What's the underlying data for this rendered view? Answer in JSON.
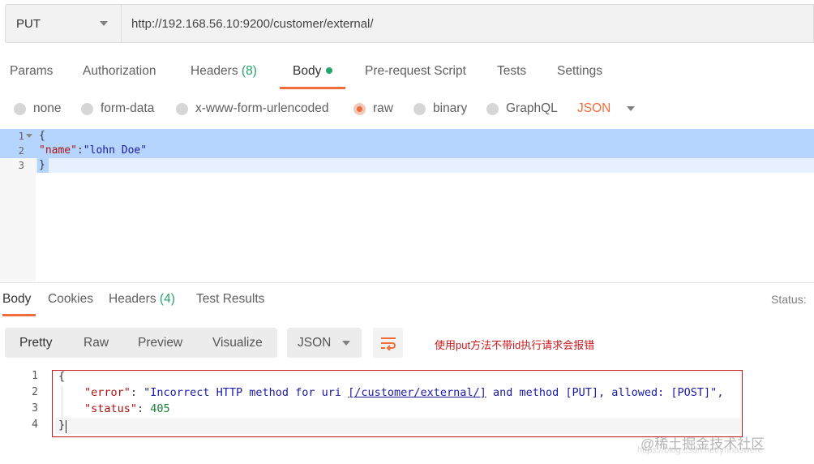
{
  "request": {
    "method": "PUT",
    "url": "http://192.168.56.10:9200/customer/external/"
  },
  "request_tabs": {
    "params": "Params",
    "authorization": "Authorization",
    "headers": "Headers",
    "headers_count": "(8)",
    "body": "Body",
    "pre_request": "Pre-request Script",
    "tests": "Tests",
    "settings": "Settings"
  },
  "body_types": {
    "none": "none",
    "form_data": "form-data",
    "urlencoded": "x-www-form-urlencoded",
    "raw": "raw",
    "binary": "binary",
    "graphql": "GraphQL",
    "selected": "raw",
    "language": "JSON"
  },
  "request_body": {
    "line_numbers": [
      "1",
      "2",
      "3"
    ],
    "line1": "{",
    "line2_key": "\"name\"",
    "line2_colon": ":",
    "line2_value": "\"lohn Doe\"",
    "line3": "}"
  },
  "response_tabs": {
    "body": "Body",
    "cookies": "Cookies",
    "headers": "Headers",
    "headers_count": "(4)",
    "test_results": "Test Results",
    "status": "Status:"
  },
  "response_toolbar": {
    "pretty": "Pretty",
    "raw": "Raw",
    "preview": "Preview",
    "visualize": "Visualize",
    "format": "JSON",
    "wrap_icon": "wrap-lines-icon"
  },
  "annotation": "使用put方法不带id执行请求会报错",
  "response_body": {
    "line_numbers": [
      "1",
      "2",
      "3",
      "4"
    ],
    "open": "{",
    "error_key": "\"error\"",
    "error_pre": "\"Incorrect HTTP method for uri ",
    "error_link": "[/customer/external/]",
    "error_post": " and method [PUT], allowed: [POST]\"",
    "status_key": "\"status\"",
    "status_value": "405",
    "close": "}"
  },
  "watermark": "@稀土掘金技术社区",
  "watermark_url": "https://blog.csdn.net/ynhaswere",
  "colors": {
    "accent": "#f26b3a",
    "count_green": "#26a26b",
    "annotation_red": "#c8181e"
  }
}
